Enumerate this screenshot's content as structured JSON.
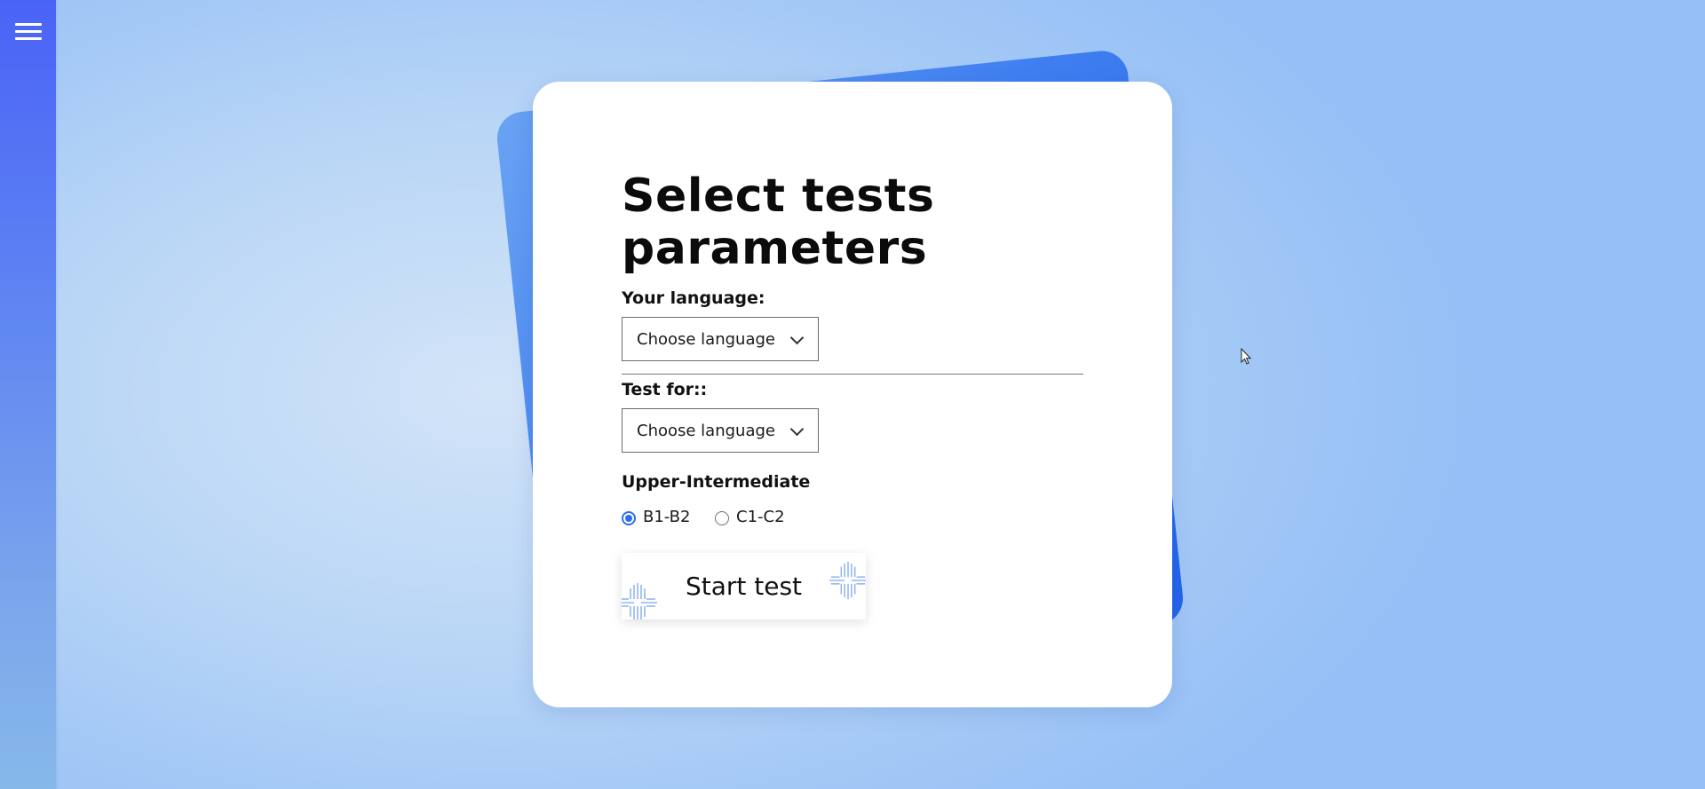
{
  "sidebar": {
    "menu_icon": "hamburger-menu-icon"
  },
  "form": {
    "title": "Select tests parameters",
    "native_language": {
      "label": "Your language:",
      "selected": "Choose language"
    },
    "target_language": {
      "label": "Test for::",
      "selected": "Choose language"
    },
    "level": {
      "label": "Upper-Intermediate",
      "options": [
        {
          "label": "B1-B2",
          "checked": true
        },
        {
          "label": "C1-C2",
          "checked": false
        }
      ]
    },
    "start_button": {
      "label": "Start test"
    }
  },
  "colors": {
    "accent": "#2b6ff0",
    "sidebar_top": "#4a63f6",
    "sidebar_bottom": "#87b8ea",
    "back_card": "#2463ea"
  }
}
